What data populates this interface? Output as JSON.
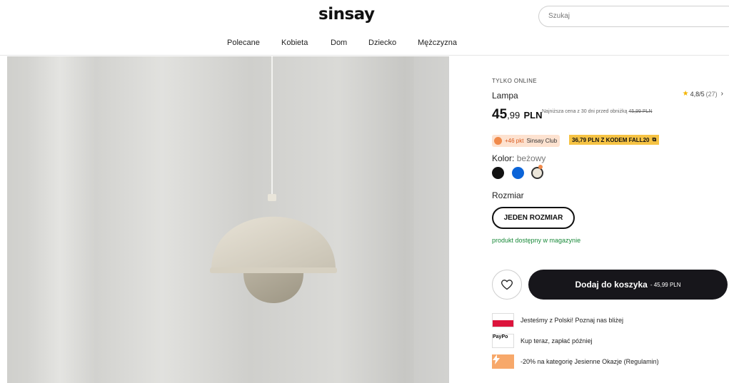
{
  "header": {
    "logo": "sinsay",
    "search_placeholder": "Szukaj",
    "nav": [
      "Polecane",
      "Kobieta",
      "Dom",
      "Dziecko",
      "Mężczyzna"
    ]
  },
  "product": {
    "badge": "TYLKO ONLINE",
    "name": "Lampa",
    "rating": "4,8/5",
    "rating_count": "(27)",
    "price_main": "45",
    "price_decimals": ",99",
    "price_currency": "PLN",
    "lowest_label": "Najniższa cena z 30 dni przed obniżką",
    "lowest_value": "45,99 PLN",
    "club_points": "+46 pkt",
    "club_name": "Sinsay Club",
    "promo_code": "36,79 PLN Z KODEM FALL20",
    "color_label": "Kolor:",
    "color_value": "beżowy",
    "colors": [
      "#121212",
      "#0b64d8",
      "#ece6da"
    ],
    "size_label": "Rozmiar",
    "size_value": "JEDEN ROZMIAR",
    "stock": "produkt dostępny w magazynie",
    "add_to_cart": "Dodaj do koszyka",
    "add_to_cart_price": "- 45,99 PLN"
  },
  "info": [
    {
      "icon": "poland-flag-icon",
      "text": "Jesteśmy z Polski! Poznaj nas bliżej"
    },
    {
      "icon": "paypo-icon",
      "icon_text": "PayPo",
      "text": "Kup teraz, zapłać później"
    },
    {
      "icon": "promo-icon",
      "text": "-20% na kategorię Jesienne Okazje (Regulamin)"
    }
  ]
}
